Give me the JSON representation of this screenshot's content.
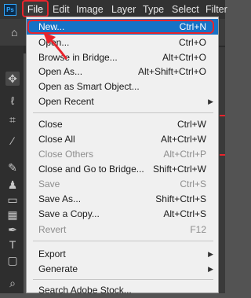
{
  "app": {
    "logo_text": "Ps"
  },
  "menubar": {
    "items": [
      "File",
      "Edit",
      "Image",
      "Layer",
      "Type",
      "Select",
      "Filter"
    ]
  },
  "toolbar_icons": [
    "move-icon",
    "lasso-icon",
    "crop-icon",
    "eyedropper-icon",
    "brush-icon",
    "stamp-icon",
    "eraser-icon",
    "gradient-icon",
    "pen-icon",
    "type-icon",
    "rectangle-icon",
    "zoom-icon"
  ],
  "file_menu": {
    "items": [
      {
        "label": "New...",
        "shortcut": "Ctrl+N",
        "highlighted": true
      },
      {
        "label": "Open...",
        "shortcut": "Ctrl+O"
      },
      {
        "label": "Browse in Bridge...",
        "shortcut": "Alt+Ctrl+O"
      },
      {
        "label": "Open As...",
        "shortcut": "Alt+Shift+Ctrl+O"
      },
      {
        "label": "Open as Smart Object...",
        "shortcut": ""
      },
      {
        "label": "Open Recent",
        "shortcut": "",
        "submenu": true
      },
      {
        "label": "Close",
        "shortcut": "Ctrl+W"
      },
      {
        "label": "Close All",
        "shortcut": "Alt+Ctrl+W"
      },
      {
        "label": "Close Others",
        "shortcut": "Alt+Ctrl+P",
        "disabled": true
      },
      {
        "label": "Close and Go to Bridge...",
        "shortcut": "Shift+Ctrl+W"
      },
      {
        "label": "Save",
        "shortcut": "Ctrl+S",
        "disabled": true
      },
      {
        "label": "Save As...",
        "shortcut": "Shift+Ctrl+S"
      },
      {
        "label": "Save a Copy...",
        "shortcut": "Alt+Ctrl+S"
      },
      {
        "label": "Revert",
        "shortcut": "F12",
        "disabled": true
      },
      {
        "label": "Export",
        "shortcut": "",
        "submenu": true
      },
      {
        "label": "Generate",
        "shortcut": "",
        "submenu": true
      },
      {
        "label": "Search Adobe Stock...",
        "shortcut": ""
      }
    ]
  },
  "colors": {
    "highlight": "#1672c6",
    "annotation": "#e8242c",
    "menu_bg": "#f0f0f0"
  }
}
